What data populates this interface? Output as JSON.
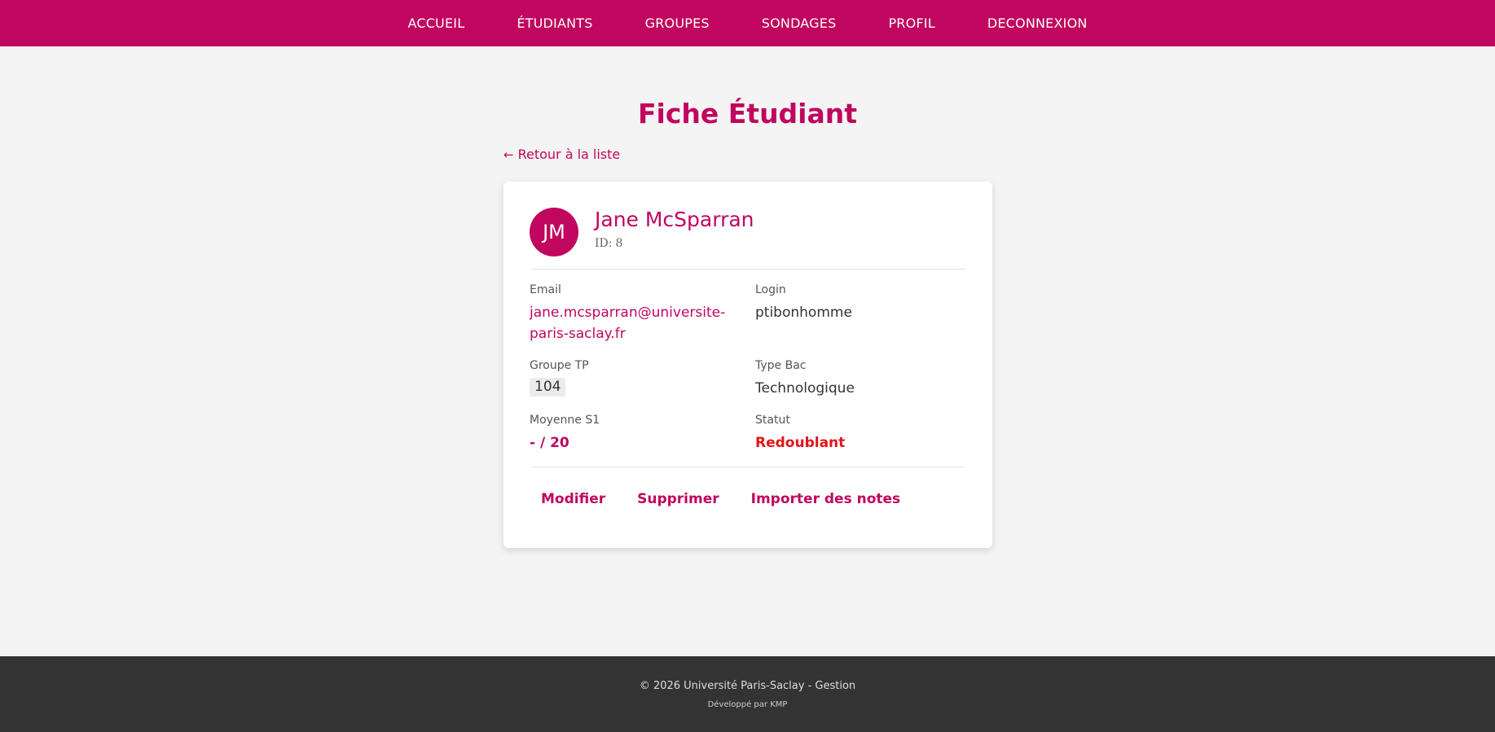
{
  "nav": {
    "items": [
      {
        "label": "ACCUEIL"
      },
      {
        "label": "ÉTUDIANTS"
      },
      {
        "label": "GROUPES"
      },
      {
        "label": "SONDAGES"
      },
      {
        "label": "PROFIL"
      },
      {
        "label": "DECONNEXION"
      }
    ]
  },
  "page": {
    "title": "Fiche Étudiant",
    "back_arrow": "←",
    "back_label": "Retour à la liste"
  },
  "student": {
    "initials": "JM",
    "name": "Jane McSparran",
    "id_label": "ID:",
    "id_value": "8",
    "fields": {
      "email_label": "Email",
      "email_value": "jane.mcsparran@universite-paris-saclay.fr",
      "login_label": "Login",
      "login_value": "ptibonhomme",
      "groupe_label": "Groupe TP",
      "groupe_value": "104",
      "bac_label": "Type Bac",
      "bac_value": "Technologique",
      "moyenne_label": "Moyenne S1",
      "moyenne_value": "- / 20",
      "statut_label": "Statut",
      "statut_value": "Redoublant"
    }
  },
  "actions": {
    "edit": "Modifier",
    "delete": "Supprimer",
    "import": "Importer des notes"
  },
  "footer": {
    "copyright": "© 2026 Université Paris-Saclay - Gestion",
    "developer": "Développé par KMP"
  },
  "colors": {
    "brand": "#c0065e",
    "danger": "#e3141b",
    "footer_bg": "#333333",
    "page_bg": "#f4f4f4"
  }
}
